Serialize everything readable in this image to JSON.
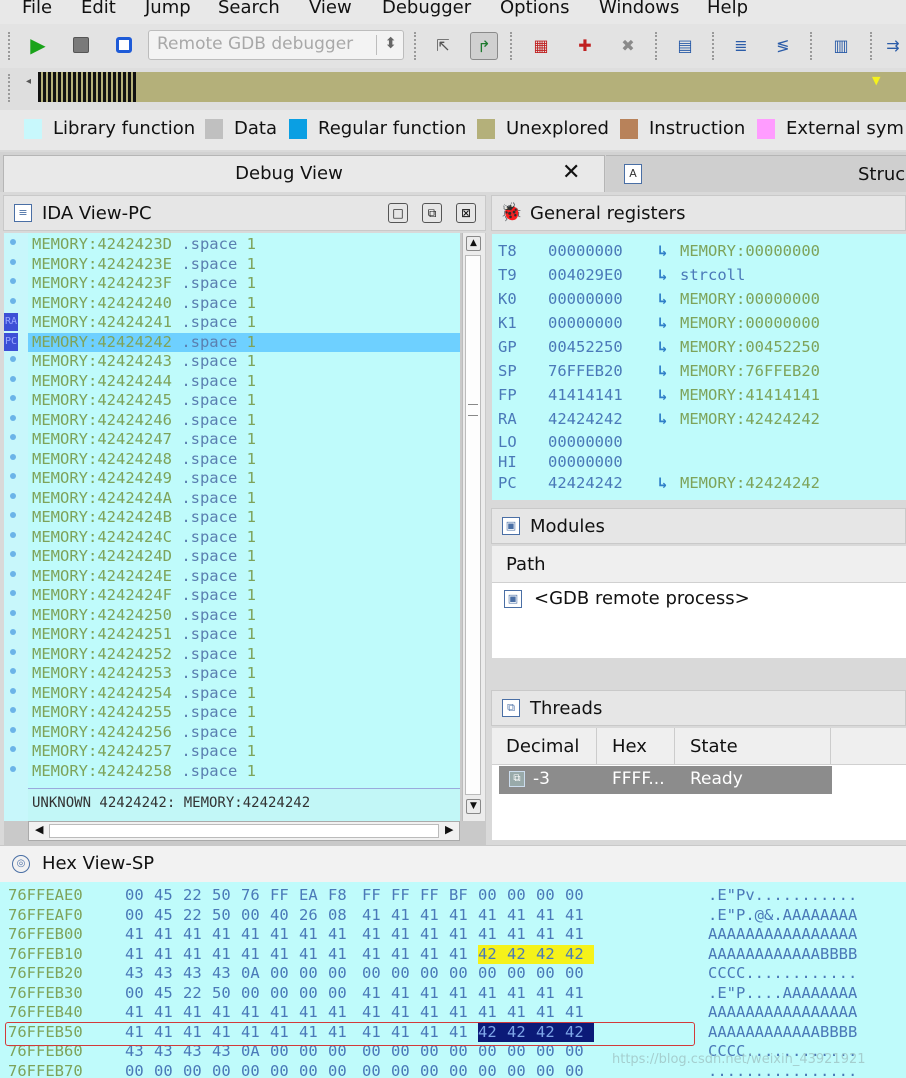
{
  "menu": [
    "File",
    "Edit",
    "Jump",
    "Search",
    "View",
    "Debugger",
    "Options",
    "Windows",
    "Help"
  ],
  "toolbar": {
    "debugger_select": "Remote GDB debugger"
  },
  "legend": [
    {
      "label": "Library function",
      "color": "#c8f8fc"
    },
    {
      "label": "Data",
      "color": "#c0c0c0"
    },
    {
      "label": "Regular function",
      "color": "#0a9fe3"
    },
    {
      "label": "Unexplored",
      "color": "#b4b07a"
    },
    {
      "label": "Instruction",
      "color": "#b8825a"
    },
    {
      "label": "External sym",
      "color": "#ff9cff"
    }
  ],
  "tabs": {
    "debug_view": "Debug View",
    "structures": "Struc"
  },
  "ida_view": {
    "title": "IDA View-PC",
    "status": "UNKNOWN 42424242: MEMORY:42424242",
    "gutter_marks": [
      "RA",
      "PC"
    ],
    "lines": [
      {
        "addr": "MEMORY:4242423D",
        "op": ".space",
        "arg": "1"
      },
      {
        "addr": "MEMORY:4242423E",
        "op": ".space",
        "arg": "1"
      },
      {
        "addr": "MEMORY:4242423F",
        "op": ".space",
        "arg": "1"
      },
      {
        "addr": "MEMORY:42424240",
        "op": ".space",
        "arg": "1"
      },
      {
        "addr": "MEMORY:42424241",
        "op": ".space",
        "arg": "1"
      },
      {
        "addr": "MEMORY:42424242",
        "op": ".space",
        "arg": "1"
      },
      {
        "addr": "MEMORY:42424243",
        "op": ".space",
        "arg": "1"
      },
      {
        "addr": "MEMORY:42424244",
        "op": ".space",
        "arg": "1"
      },
      {
        "addr": "MEMORY:42424245",
        "op": ".space",
        "arg": "1"
      },
      {
        "addr": "MEMORY:42424246",
        "op": ".space",
        "arg": "1"
      },
      {
        "addr": "MEMORY:42424247",
        "op": ".space",
        "arg": "1"
      },
      {
        "addr": "MEMORY:42424248",
        "op": ".space",
        "arg": "1"
      },
      {
        "addr": "MEMORY:42424249",
        "op": ".space",
        "arg": "1"
      },
      {
        "addr": "MEMORY:4242424A",
        "op": ".space",
        "arg": "1"
      },
      {
        "addr": "MEMORY:4242424B",
        "op": ".space",
        "arg": "1"
      },
      {
        "addr": "MEMORY:4242424C",
        "op": ".space",
        "arg": "1"
      },
      {
        "addr": "MEMORY:4242424D",
        "op": ".space",
        "arg": "1"
      },
      {
        "addr": "MEMORY:4242424E",
        "op": ".space",
        "arg": "1"
      },
      {
        "addr": "MEMORY:4242424F",
        "op": ".space",
        "arg": "1"
      },
      {
        "addr": "MEMORY:42424250",
        "op": ".space",
        "arg": "1"
      },
      {
        "addr": "MEMORY:42424251",
        "op": ".space",
        "arg": "1"
      },
      {
        "addr": "MEMORY:42424252",
        "op": ".space",
        "arg": "1"
      },
      {
        "addr": "MEMORY:42424253",
        "op": ".space",
        "arg": "1"
      },
      {
        "addr": "MEMORY:42424254",
        "op": ".space",
        "arg": "1"
      },
      {
        "addr": "MEMORY:42424255",
        "op": ".space",
        "arg": "1"
      },
      {
        "addr": "MEMORY:42424256",
        "op": ".space",
        "arg": "1"
      },
      {
        "addr": "MEMORY:42424257",
        "op": ".space",
        "arg": "1"
      },
      {
        "addr": "MEMORY:42424258",
        "op": ".space",
        "arg": "1"
      }
    ]
  },
  "registers": {
    "title": "General registers",
    "rows": [
      {
        "name": "T8",
        "value": "00000000",
        "target": "MEMORY:00000000"
      },
      {
        "name": "T9",
        "value": "004029E0",
        "target": "strcoll"
      },
      {
        "name": "K0",
        "value": "00000000",
        "target": "MEMORY:00000000"
      },
      {
        "name": "K1",
        "value": "00000000",
        "target": "MEMORY:00000000"
      },
      {
        "name": "GP",
        "value": "00452250",
        "target": "MEMORY:00452250"
      },
      {
        "name": "SP",
        "value": "76FFEB20",
        "target": "MEMORY:76FFEB20"
      },
      {
        "name": "FP",
        "value": "41414141",
        "target": "MEMORY:41414141"
      },
      {
        "name": "RA",
        "value": "42424242",
        "target": "MEMORY:42424242"
      },
      {
        "name": "LO",
        "value": "00000000",
        "target": ""
      },
      {
        "name": "HI",
        "value": "00000000",
        "target": ""
      },
      {
        "name": "PC",
        "value": "42424242",
        "target": "MEMORY:42424242"
      }
    ]
  },
  "modules": {
    "title": "Modules",
    "column": "Path",
    "rows": [
      "<GDB remote process>"
    ]
  },
  "threads": {
    "title": "Threads",
    "columns": [
      "Decimal",
      "Hex",
      "State"
    ],
    "row": {
      "decimal": "-3",
      "hex": "FFFF...",
      "state": "Ready"
    }
  },
  "hex_view": {
    "title": "Hex View-SP",
    "rows": [
      {
        "addr": "76FFEAE0",
        "bytes": [
          "00",
          "45",
          "22",
          "50",
          "76",
          "FF",
          "EA",
          "F8",
          "FF",
          "FF",
          "FF",
          "BF",
          "00",
          "00",
          "00",
          "00"
        ],
        "ascii": ".E\"Pv..........."
      },
      {
        "addr": "76FFEAF0",
        "bytes": [
          "00",
          "45",
          "22",
          "50",
          "00",
          "40",
          "26",
          "08",
          "41",
          "41",
          "41",
          "41",
          "41",
          "41",
          "41",
          "41"
        ],
        "ascii": ".E\"P.@&.AAAAAAAA"
      },
      {
        "addr": "76FFEB00",
        "bytes": [
          "41",
          "41",
          "41",
          "41",
          "41",
          "41",
          "41",
          "41",
          "41",
          "41",
          "41",
          "41",
          "41",
          "41",
          "41",
          "41"
        ],
        "ascii": "AAAAAAAAAAAAAAAA"
      },
      {
        "addr": "76FFEB10",
        "bytes": [
          "41",
          "41",
          "41",
          "41",
          "41",
          "41",
          "41",
          "41",
          "41",
          "41",
          "41",
          "41",
          "42",
          "42",
          "42",
          "42"
        ],
        "ascii": "AAAAAAAAAAAABBBB"
      },
      {
        "addr": "76FFEB20",
        "bytes": [
          "43",
          "43",
          "43",
          "43",
          "0A",
          "00",
          "00",
          "00",
          "00",
          "00",
          "00",
          "00",
          "00",
          "00",
          "00",
          "00"
        ],
        "ascii": "CCCC............"
      },
      {
        "addr": "76FFEB30",
        "bytes": [
          "00",
          "45",
          "22",
          "50",
          "00",
          "00",
          "00",
          "00",
          "41",
          "41",
          "41",
          "41",
          "41",
          "41",
          "41",
          "41"
        ],
        "ascii": ".E\"P....AAAAAAAA"
      },
      {
        "addr": "76FFEB40",
        "bytes": [
          "41",
          "41",
          "41",
          "41",
          "41",
          "41",
          "41",
          "41",
          "41",
          "41",
          "41",
          "41",
          "41",
          "41",
          "41",
          "41"
        ],
        "ascii": "AAAAAAAAAAAAAAAA"
      },
      {
        "addr": "76FFEB50",
        "bytes": [
          "41",
          "41",
          "41",
          "41",
          "41",
          "41",
          "41",
          "41",
          "41",
          "41",
          "41",
          "41",
          "42",
          "42",
          "42",
          "42"
        ],
        "ascii": "AAAAAAAAAAAABBBB"
      },
      {
        "addr": "76FFEB60",
        "bytes": [
          "43",
          "43",
          "43",
          "43",
          "0A",
          "00",
          "00",
          "00",
          "00",
          "00",
          "00",
          "00",
          "00",
          "00",
          "00",
          "00"
        ],
        "ascii": "CCCC............"
      },
      {
        "addr": "76FFEB70",
        "bytes": [
          "00",
          "00",
          "00",
          "00",
          "00",
          "00",
          "00",
          "00",
          "00",
          "00",
          "00",
          "00",
          "00",
          "00",
          "00",
          "00"
        ],
        "ascii": "................"
      }
    ],
    "watermark": "https://blog.csdn.net/weixin_43921921"
  }
}
